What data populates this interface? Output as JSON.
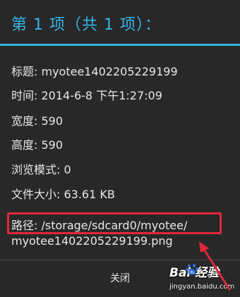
{
  "dialog": {
    "title": "第 1 项（共 1 项）：",
    "details": {
      "title_row": "标题: myotee1402205229199",
      "time_row": "时间: 2014-6-8 下午1:27:09",
      "width_row": "宽度: 590",
      "height_row": "高度: 590",
      "browse_mode_row": "浏览模式: 0",
      "file_size_row": "文件大小: 63.61 KB",
      "path_row": "路径: /storage/sdcard0/myotee/",
      "path_row_continued": "myotee1402205229199.png"
    },
    "close_label": "关闭"
  },
  "watermark": {
    "logo": "Bai 经验",
    "site": "jingyan.baidu.com"
  },
  "colors": {
    "accent": "#33b5e5",
    "highlight": "#e0283a",
    "dialog_background": "#282828"
  },
  "icons": {
    "annotation_arrow": "red-arrow-icon",
    "watermark_logo": "baidu-paw-icon"
  }
}
